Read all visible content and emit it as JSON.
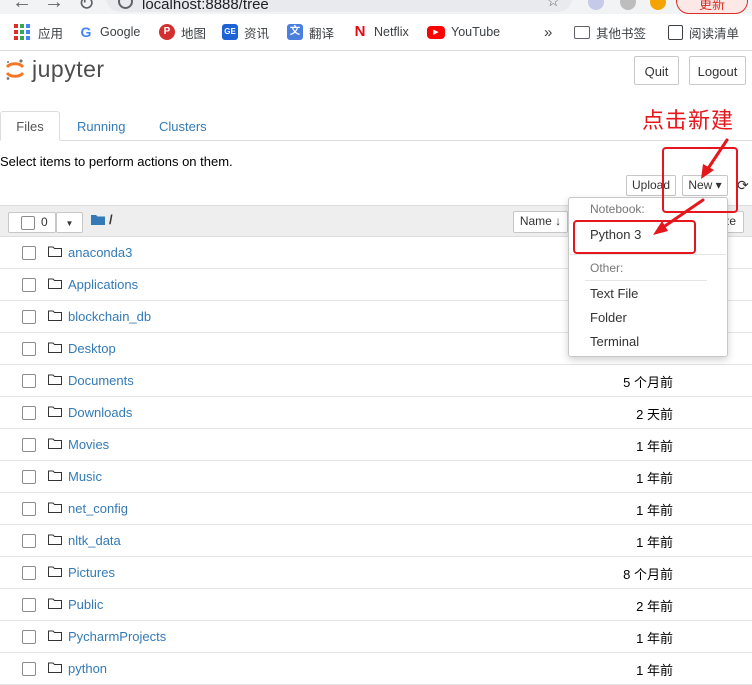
{
  "browser": {
    "url": "localhost:8888/tree",
    "update_label": "更新",
    "bookmarks": [
      {
        "label": "应用",
        "icon": "apps-grid-icon"
      },
      {
        "label": "Google",
        "icon": "google-icon"
      },
      {
        "label": "地图",
        "icon": "map-icon"
      },
      {
        "label": "资讯",
        "icon": "news-icon"
      },
      {
        "label": "翻译",
        "icon": "translate-icon"
      },
      {
        "label": "Netflix",
        "icon": "netflix-icon"
      },
      {
        "label": "YouTube",
        "icon": "youtube-icon"
      }
    ],
    "more_bookmarks": "»",
    "other_bookmarks": "其他书签",
    "reading_list": "阅读清单"
  },
  "header": {
    "logo_text": "jupyter",
    "quit_label": "Quit",
    "logout_label": "Logout"
  },
  "tabs": [
    {
      "label": "Files",
      "active": true
    },
    {
      "label": "Running",
      "active": false
    },
    {
      "label": "Clusters",
      "active": false
    }
  ],
  "toolbar": {
    "select_message": "Select items to perform actions on them.",
    "upload_label": "Upload",
    "new_label": "New ▾",
    "selected_count": "0",
    "breadcrumb_root": "/",
    "sort_name_label": "Name ↓",
    "size_label_partial": "ze"
  },
  "files": [
    {
      "name": "anaconda3",
      "modified": ""
    },
    {
      "name": "Applications",
      "modified": ""
    },
    {
      "name": "blockchain_db",
      "modified": ""
    },
    {
      "name": "Desktop",
      "modified": ""
    },
    {
      "name": "Documents",
      "modified": "5 个月前"
    },
    {
      "name": "Downloads",
      "modified": "2 天前"
    },
    {
      "name": "Movies",
      "modified": "1 年前"
    },
    {
      "name": "Music",
      "modified": "1 年前"
    },
    {
      "name": "net_config",
      "modified": "1 年前"
    },
    {
      "name": "nltk_data",
      "modified": "1 年前"
    },
    {
      "name": "Pictures",
      "modified": "8 个月前"
    },
    {
      "name": "Public",
      "modified": "2 年前"
    },
    {
      "name": "PycharmProjects",
      "modified": "1 年前"
    },
    {
      "name": "python",
      "modified": "1 年前"
    }
  ],
  "new_menu": {
    "notebook_header": "Notebook:",
    "python3": "Python 3",
    "other_header": "Other:",
    "text_file": "Text File",
    "folder": "Folder",
    "terminal": "Terminal"
  },
  "annotation": {
    "text": "点击新建",
    "color": "#e5161c"
  }
}
